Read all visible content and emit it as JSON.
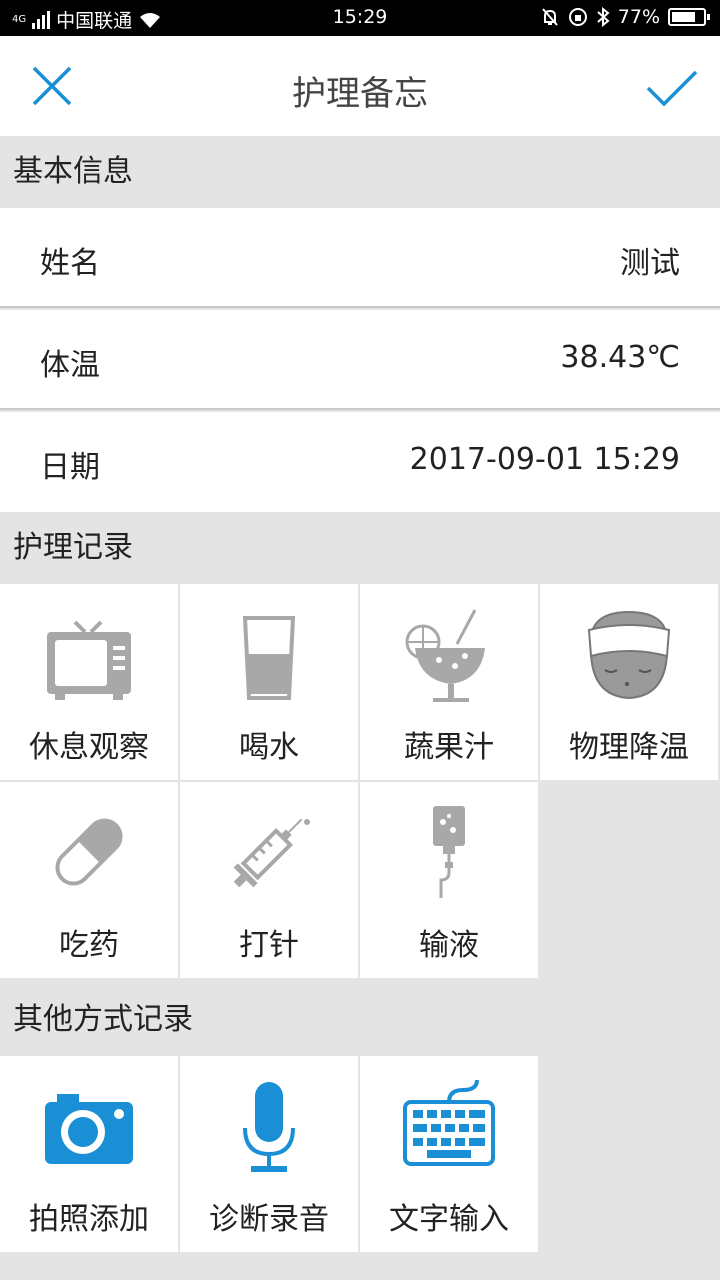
{
  "status_bar": {
    "carrier": "中国联通",
    "network": "4G",
    "time": "15:29",
    "battery": "77%",
    "battery_level": 0.77
  },
  "header": {
    "title": "护理备忘"
  },
  "basic_info": {
    "title": "基本信息",
    "rows": [
      {
        "label": "姓名",
        "value": "测试"
      },
      {
        "label": "体温",
        "value": "38.43℃"
      },
      {
        "label": "日期",
        "value": "2017-09-01 15:29"
      }
    ]
  },
  "care_records": {
    "title": "护理记录",
    "items": [
      {
        "label": "休息观察",
        "icon": "tv-icon"
      },
      {
        "label": "喝水",
        "icon": "water-glass-icon"
      },
      {
        "label": "蔬果汁",
        "icon": "juice-icon"
      },
      {
        "label": "物理降温",
        "icon": "cooling-towel-icon"
      },
      {
        "label": "吃药",
        "icon": "pill-icon"
      },
      {
        "label": "打针",
        "icon": "syringe-icon"
      },
      {
        "label": "输液",
        "icon": "iv-drip-icon"
      }
    ]
  },
  "other_records": {
    "title": "其他方式记录",
    "items": [
      {
        "label": "拍照添加",
        "icon": "camera-icon"
      },
      {
        "label": "诊断录音",
        "icon": "microphone-icon"
      },
      {
        "label": "文字输入",
        "icon": "keyboard-icon"
      }
    ]
  },
  "colors": {
    "accent": "#1a8fd6",
    "icon_gray": "#a8a8a8",
    "section_bg": "#e4e4e4"
  }
}
